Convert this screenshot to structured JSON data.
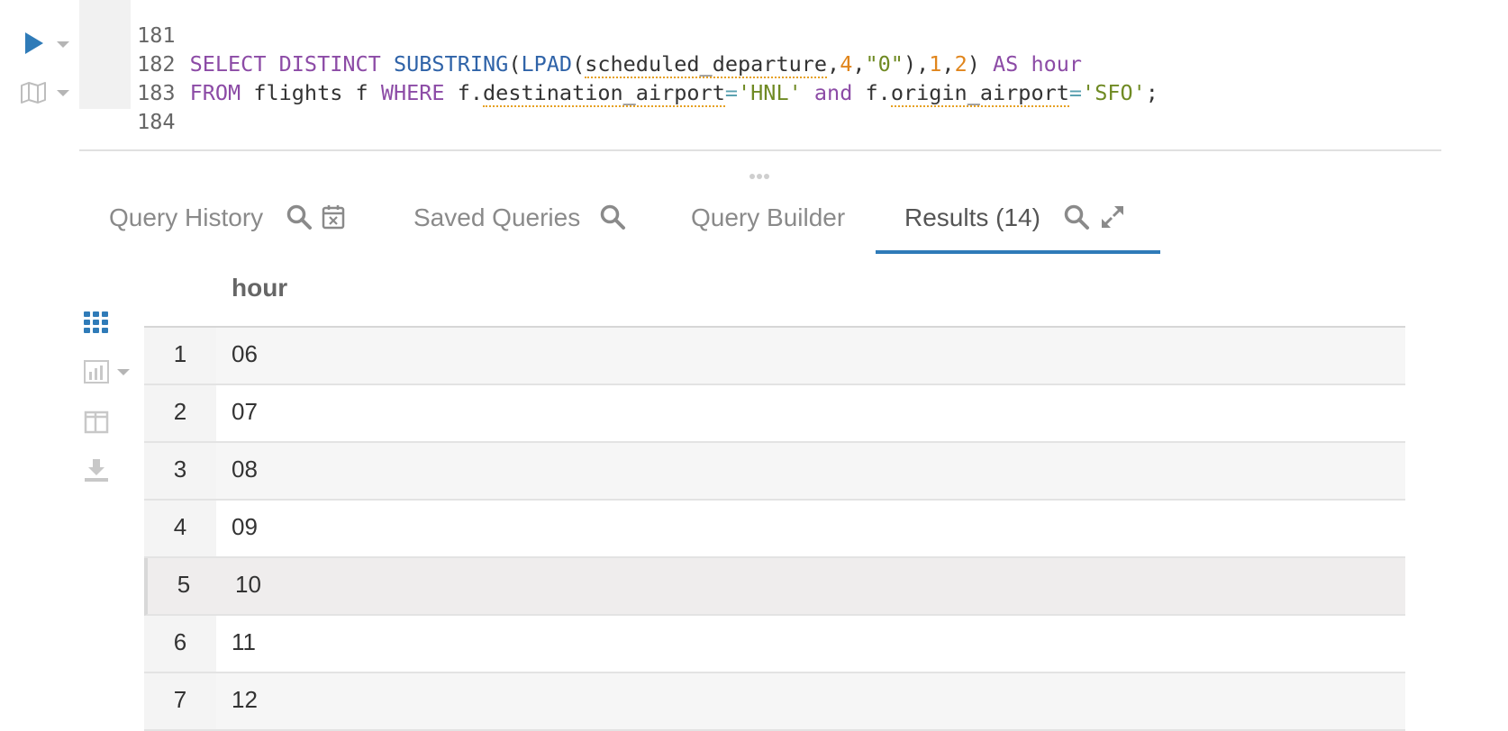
{
  "editor": {
    "lines": [
      {
        "num": "181"
      },
      {
        "num": "182",
        "tokens": {
          "t1": "SELECT DISTINCT ",
          "t2": "SUBSTRING",
          "t3": "(",
          "t4": "LPAD",
          "t5": "(",
          "t6": "scheduled_departure",
          "t7": ",",
          "t8": "4",
          "t9": ",",
          "t10": "\"0\"",
          "t11": "),",
          "t12": "1",
          "t13": ",",
          "t14": "2",
          "t15": ") ",
          "t16": "AS",
          "t17": " hour"
        }
      },
      {
        "num": "183",
        "tokens": {
          "t1": "FROM",
          "t2": " flights f ",
          "t3": "WHERE",
          "t4": " f.",
          "t5": "destination_airport",
          "t6": "=",
          "t7": "'HNL'",
          "t8": " and",
          "t9": " f.",
          "t10": "origin_airport",
          "t11": "=",
          "t12": "'SFO'",
          "t13": ";"
        }
      },
      {
        "num": "184"
      }
    ],
    "icons": {
      "run": "play-icon",
      "map": "map-icon"
    }
  },
  "tabs": [
    {
      "label": "Query History"
    },
    {
      "label": "Saved Queries"
    },
    {
      "label": "Query Builder"
    },
    {
      "label": "Results (14)"
    }
  ],
  "accent_color": "#2f7bb8",
  "results": {
    "columns": [
      "hour"
    ],
    "rows": [
      {
        "idx": "1",
        "hour": "06"
      },
      {
        "idx": "2",
        "hour": "07"
      },
      {
        "idx": "3",
        "hour": "08"
      },
      {
        "idx": "4",
        "hour": "09"
      },
      {
        "idx": "5",
        "hour": "10"
      },
      {
        "idx": "6",
        "hour": "11"
      },
      {
        "idx": "7",
        "hour": "12"
      }
    ]
  }
}
